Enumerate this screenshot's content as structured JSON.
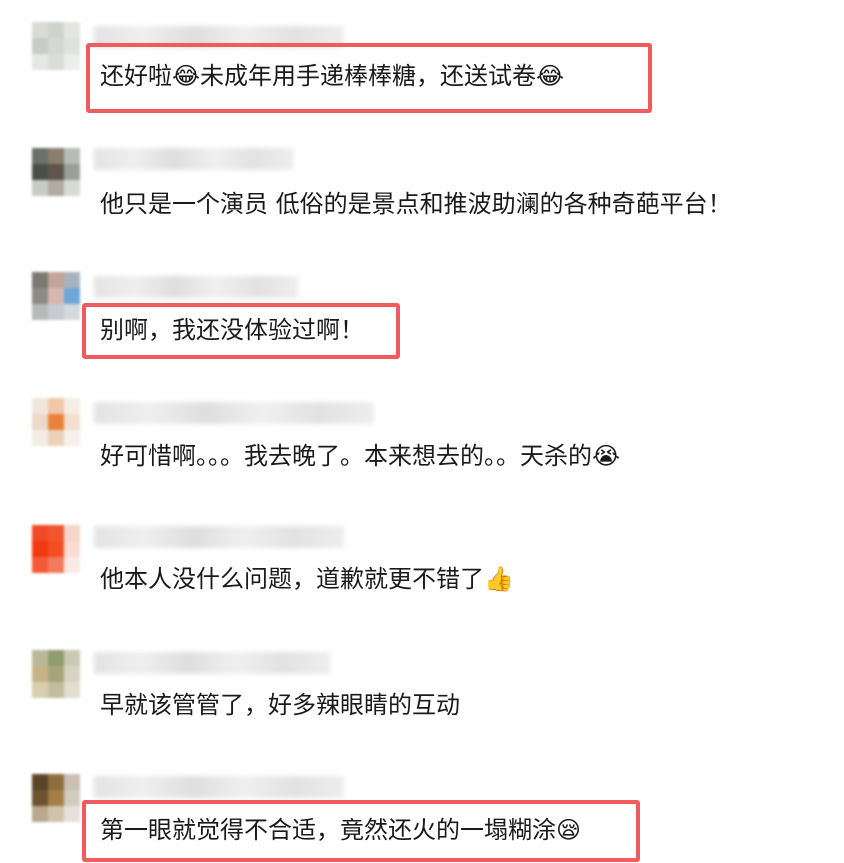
{
  "comments": [
    {
      "text": "还好啦😂未成年用手递棒棒糖，还送试卷😂",
      "highlighted": true
    },
    {
      "text": "他只是一个演员 低俗的是景点和推波助澜的各种奇葩平台！",
      "highlighted": false
    },
    {
      "text": "别啊，我还没体验过啊！",
      "highlighted": true
    },
    {
      "text": "好可惜啊。。。我去晚了。本来想去的。。天杀的😭",
      "highlighted": false
    },
    {
      "text": "他本人没什么问题，道歉就更不错了👍",
      "highlighted": false
    },
    {
      "text": "早就该管管了，好多辣眼睛的互动",
      "highlighted": false
    },
    {
      "text": "第一眼就觉得不合适，竟然还火的一塌糊涂😪",
      "highlighted": true
    }
  ],
  "colors": {
    "highlight": "#f15b5e",
    "text": "#1a1a1a"
  }
}
